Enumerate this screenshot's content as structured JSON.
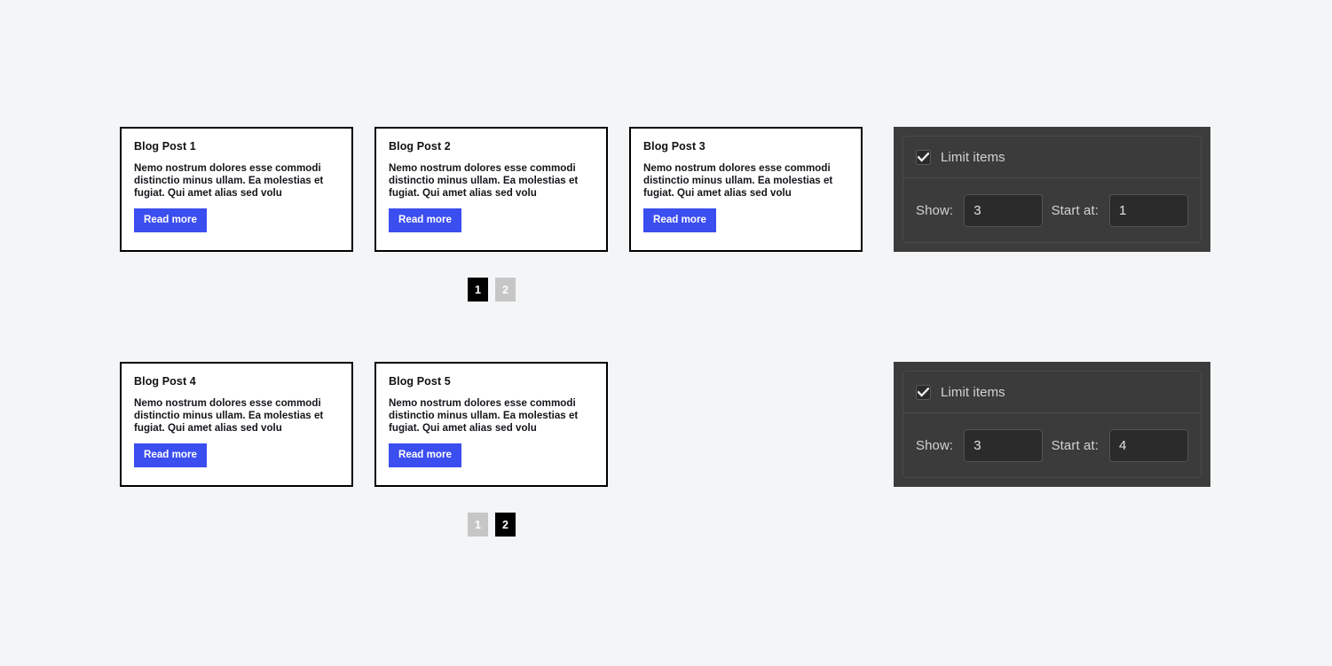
{
  "page": {
    "background_color": "#f4f5f7",
    "accent_color": "#3b4ef0"
  },
  "sections": [
    {
      "id": "section-page-1",
      "posts": [
        {
          "title": "Blog Post 1",
          "body": "Nemo nostrum dolores esse commodi distinctio minus ullam. Ea molestias et fugiat. Qui amet alias sed volu",
          "button_label": "Read more"
        },
        {
          "title": "Blog Post 2",
          "body": "Nemo nostrum dolores esse commodi distinctio minus ullam. Ea molestias et fugiat. Qui amet alias sed volu",
          "button_label": "Read more"
        },
        {
          "title": "Blog Post 3",
          "body": "Nemo nostrum dolores esse commodi distinctio minus ullam. Ea molestias et fugiat. Qui amet alias sed volu",
          "button_label": "Read more"
        }
      ],
      "pagination": [
        {
          "label": "1",
          "state": "active"
        },
        {
          "label": "2",
          "state": "inactive"
        }
      ],
      "controls": {
        "checkbox": {
          "label": "Limit items",
          "checked": true,
          "icon": "check-icon"
        },
        "show": {
          "label": "Show:",
          "value": "3"
        },
        "start_at": {
          "label": "Start at:",
          "value": "1"
        }
      }
    },
    {
      "id": "section-page-2",
      "posts": [
        {
          "title": "Blog Post 4",
          "body": "Nemo nostrum dolores esse commodi distinctio minus ullam. Ea molestias et fugiat. Qui amet alias sed volu",
          "button_label": "Read more"
        },
        {
          "title": "Blog Post 5",
          "body": "Nemo nostrum dolores esse commodi distinctio minus ullam. Ea molestias et fugiat. Qui amet alias sed volu",
          "button_label": "Read more"
        }
      ],
      "pagination": [
        {
          "label": "1",
          "state": "inactive"
        },
        {
          "label": "2",
          "state": "active"
        }
      ],
      "controls": {
        "checkbox": {
          "label": "Limit items",
          "checked": true,
          "icon": "check-icon"
        },
        "show": {
          "label": "Show:",
          "value": "3"
        },
        "start_at": {
          "label": "Start at:",
          "value": "4"
        }
      }
    }
  ]
}
